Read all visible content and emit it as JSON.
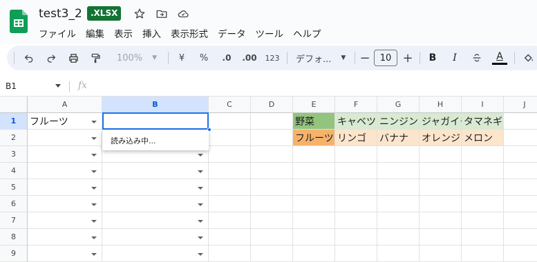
{
  "header": {
    "doc_title": "test3_2",
    "file_badge": ".XLSX",
    "menu": [
      "ファイル",
      "編集",
      "表示",
      "挿入",
      "表示形式",
      "データ",
      "ツール",
      "ヘルプ"
    ]
  },
  "toolbar": {
    "zoom": "100%",
    "currency": "¥",
    "percent": "%",
    "dec_decrease": ".0",
    "dec_increase": ".00",
    "number_format": "123",
    "font_name": "デフォ...",
    "font_size": "10",
    "bold": "B",
    "italic": "I",
    "text_color": "A"
  },
  "formula_bar": {
    "name_box": "B1",
    "fx": "fx"
  },
  "columns": [
    "A",
    "B",
    "C",
    "D",
    "E",
    "F",
    "G",
    "H",
    "I",
    "J"
  ],
  "rows": [
    "1",
    "2",
    "3",
    "4",
    "5",
    "6",
    "7",
    "8",
    "9"
  ],
  "selected": {
    "column": "B",
    "row": "1"
  },
  "cells": {
    "A1": "フルーツ",
    "E1": "野菜",
    "F1": "キャベツ",
    "G1": "ニンジン",
    "H1": "ジャガイモ",
    "I1": "タマネギ",
    "E2": "フルーツ",
    "F2": "リンゴ",
    "G2": "バナナ",
    "H2": "オレンジ",
    "I2": "メロン"
  },
  "dropdown_popup": {
    "loading_text": "読み込み中..."
  },
  "colors": {
    "badge": "#137333",
    "veg_header": "#93c47d",
    "veg_items": "#d9ead3",
    "fruit_header": "#f6b26b",
    "fruit_items": "#fce5cd",
    "selection": "#1a73e8"
  }
}
